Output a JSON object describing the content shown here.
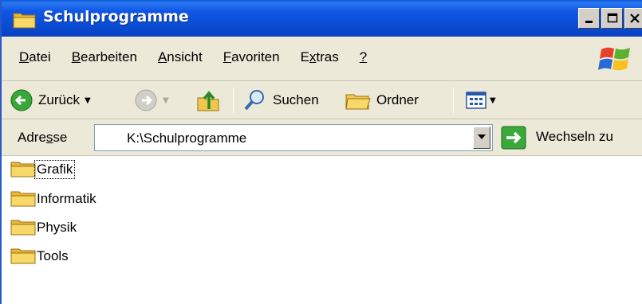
{
  "window": {
    "title": "Schulprogramme"
  },
  "menu": [
    {
      "pre": "",
      "ul": "D",
      "post": "atei"
    },
    {
      "pre": "",
      "ul": "B",
      "post": "earbeiten"
    },
    {
      "pre": "",
      "ul": "A",
      "post": "nsicht"
    },
    {
      "pre": "",
      "ul": "F",
      "post": "avoriten"
    },
    {
      "pre": "E",
      "ul": "x",
      "post": "tras"
    },
    {
      "pre": "",
      "ul": "?",
      "post": ""
    }
  ],
  "toolbar": {
    "back_label": "Zurück",
    "search_label": "Suchen",
    "folders_label": "Ordner"
  },
  "address": {
    "label_pre": "Adre",
    "label_ul": "s",
    "label_post": "se",
    "value": "K:\\Schulprogramme",
    "go_label": "Wechseln zu"
  },
  "folders": [
    "Grafik",
    "Informatik",
    "Physik",
    "Tools"
  ],
  "colors": {
    "titlebar": "#0a4fd8",
    "chrome": "#ece9d8",
    "folder": "#f0c850"
  }
}
